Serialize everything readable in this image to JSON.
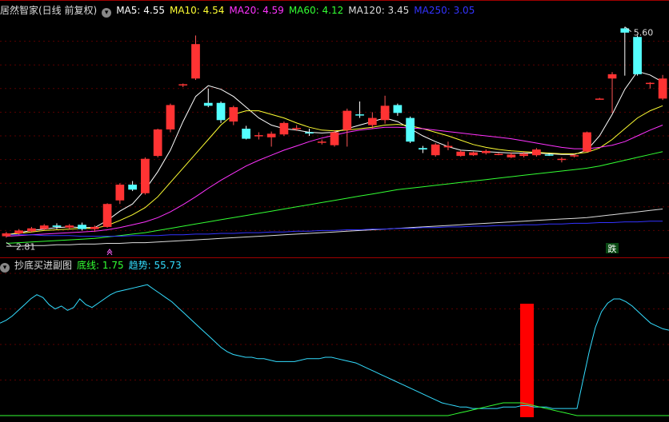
{
  "main_header": {
    "title": "居然智家(日线 前复权)",
    "ma_items": [
      {
        "label": "MA5: 4.55",
        "color": "#ffffff"
      },
      {
        "label": "MA10: 4.54",
        "color": "#ffff33"
      },
      {
        "label": "MA20: 4.59",
        "color": "#ff33ff"
      },
      {
        "label": "MA60: 4.12",
        "color": "#33ff33"
      },
      {
        "label": "MA120: 3.45",
        "color": "#dddddd"
      },
      {
        "label": "MA250: 3.05",
        "color": "#3333ff"
      }
    ]
  },
  "sub_header": {
    "title": "抄底买进副图",
    "items": [
      {
        "label": "底线: 1.75",
        "color": "#33ff33"
      },
      {
        "label": "趋势: 55.73",
        "color": "#33ddff"
      }
    ]
  },
  "annotations": {
    "high_label": "5.60",
    "low_label": "2.81",
    "sell_marker": "跌"
  },
  "chart_data": [
    {
      "type": "candlestick",
      "title": "居然智家(日线 前复权)",
      "y_range": [
        2.55,
        5.85
      ],
      "x_count": 53,
      "candles": [
        [
          2.8,
          2.86,
          2.78,
          2.84
        ],
        [
          2.84,
          2.9,
          2.82,
          2.88
        ],
        [
          2.87,
          2.93,
          2.85,
          2.91
        ],
        [
          2.9,
          2.97,
          2.88,
          2.95
        ],
        [
          2.95,
          2.98,
          2.9,
          2.93
        ],
        [
          2.92,
          2.97,
          2.89,
          2.95
        ],
        [
          2.96,
          2.99,
          2.88,
          2.9
        ],
        [
          2.9,
          2.95,
          2.86,
          2.93
        ],
        [
          2.93,
          3.26,
          2.92,
          3.25
        ],
        [
          3.3,
          3.54,
          3.25,
          3.52
        ],
        [
          3.52,
          3.57,
          3.43,
          3.45
        ],
        [
          3.4,
          3.9,
          3.38,
          3.88
        ],
        [
          3.92,
          4.3,
          3.9,
          4.29
        ],
        [
          4.29,
          4.65,
          4.25,
          4.63
        ],
        [
          4.92,
          4.93,
          4.88,
          4.92
        ],
        [
          5.0,
          5.6,
          4.98,
          5.48
        ],
        [
          4.66,
          4.86,
          4.6,
          4.62
        ],
        [
          4.66,
          4.68,
          4.38,
          4.42
        ],
        [
          4.4,
          4.62,
          4.35,
          4.6
        ],
        [
          4.3,
          4.34,
          4.15,
          4.16
        ],
        [
          4.2,
          4.25,
          4.15,
          4.21
        ],
        [
          4.18,
          4.26,
          4.05,
          4.23
        ],
        [
          4.22,
          4.4,
          4.2,
          4.38
        ],
        [
          4.3,
          4.35,
          4.27,
          4.31
        ],
        [
          4.25,
          4.3,
          4.2,
          4.24
        ],
        [
          4.12,
          4.15,
          4.08,
          4.12
        ],
        [
          4.07,
          4.28,
          4.05,
          4.25
        ],
        [
          4.28,
          4.58,
          4.05,
          4.55
        ],
        [
          4.5,
          4.68,
          4.45,
          4.49
        ],
        [
          4.35,
          4.53,
          4.3,
          4.45
        ],
        [
          4.42,
          4.76,
          4.37,
          4.62
        ],
        [
          4.63,
          4.65,
          4.48,
          4.52
        ],
        [
          4.45,
          4.47,
          4.1,
          4.12
        ],
        [
          4.03,
          4.06,
          3.96,
          4.01
        ],
        [
          3.93,
          4.1,
          3.91,
          4.08
        ],
        [
          4.04,
          4.12,
          4.0,
          4.06
        ],
        [
          3.92,
          4.0,
          3.91,
          3.98
        ],
        [
          3.93,
          3.98,
          3.92,
          3.97
        ],
        [
          3.96,
          4.01,
          3.94,
          3.99
        ],
        [
          3.94,
          3.96,
          3.93,
          3.95
        ],
        [
          3.9,
          3.97,
          3.89,
          3.94
        ],
        [
          3.92,
          3.98,
          3.9,
          3.95
        ],
        [
          3.93,
          4.03,
          3.91,
          4.01
        ],
        [
          3.94,
          3.96,
          3.92,
          3.93
        ],
        [
          3.88,
          3.9,
          3.83,
          3.88
        ],
        [
          3.92,
          3.95,
          3.9,
          3.93
        ],
        [
          3.98,
          4.26,
          3.97,
          4.25
        ],
        [
          4.72,
          4.73,
          4.71,
          4.72
        ],
        [
          5.0,
          5.09,
          4.52,
          5.06
        ],
        [
          5.7,
          5.72,
          5.04,
          5.64
        ],
        [
          5.58,
          5.6,
          5.04,
          5.06
        ],
        [
          4.94,
          4.95,
          4.86,
          4.94
        ],
        [
          4.72,
          5.05,
          4.7,
          5.0
        ]
      ],
      "candles_fields": [
        "open",
        "high",
        "low",
        "close"
      ],
      "ma": {
        "MA5": [
          2.82,
          2.85,
          2.88,
          2.9,
          2.92,
          2.93,
          2.92,
          2.92,
          3.02,
          3.15,
          3.25,
          3.45,
          3.7,
          4.0,
          4.4,
          4.75,
          4.9,
          4.85,
          4.75,
          4.6,
          4.45,
          4.35,
          4.3,
          4.28,
          4.25,
          4.24,
          4.25,
          4.3,
          4.35,
          4.4,
          4.45,
          4.4,
          4.3,
          4.2,
          4.12,
          4.05,
          4.0,
          3.99,
          3.98,
          3.97,
          3.96,
          3.96,
          3.96,
          3.95,
          3.94,
          3.94,
          4.0,
          4.2,
          4.5,
          4.85,
          5.1,
          5.05,
          4.95
        ],
        "MA10": [
          2.82,
          2.84,
          2.86,
          2.88,
          2.89,
          2.9,
          2.91,
          2.91,
          2.95,
          3.02,
          3.1,
          3.2,
          3.35,
          3.55,
          3.75,
          3.95,
          4.15,
          4.35,
          4.5,
          4.55,
          4.55,
          4.5,
          4.45,
          4.38,
          4.32,
          4.28,
          4.27,
          4.28,
          4.3,
          4.32,
          4.35,
          4.36,
          4.34,
          4.3,
          4.25,
          4.2,
          4.14,
          4.08,
          4.04,
          4.01,
          3.99,
          3.98,
          3.97,
          3.96,
          3.95,
          3.95,
          3.97,
          4.03,
          4.15,
          4.3,
          4.45,
          4.55,
          4.62
        ],
        "MA20": [
          2.8,
          2.81,
          2.82,
          2.83,
          2.84,
          2.85,
          2.86,
          2.87,
          2.89,
          2.92,
          2.96,
          3.0,
          3.06,
          3.14,
          3.24,
          3.35,
          3.47,
          3.58,
          3.68,
          3.78,
          3.86,
          3.93,
          4.0,
          4.06,
          4.12,
          4.17,
          4.21,
          4.25,
          4.28,
          4.3,
          4.32,
          4.32,
          4.31,
          4.3,
          4.28,
          4.26,
          4.24,
          4.22,
          4.2,
          4.18,
          4.16,
          4.13,
          4.1,
          4.07,
          4.04,
          4.02,
          4.02,
          4.04,
          4.07,
          4.12,
          4.2,
          4.28,
          4.35
        ],
        "MA60": [
          2.7,
          2.71,
          2.72,
          2.73,
          2.74,
          2.75,
          2.76,
          2.77,
          2.79,
          2.81,
          2.83,
          2.85,
          2.88,
          2.91,
          2.94,
          2.97,
          3.0,
          3.03,
          3.06,
          3.09,
          3.12,
          3.15,
          3.18,
          3.21,
          3.24,
          3.27,
          3.3,
          3.33,
          3.36,
          3.39,
          3.42,
          3.45,
          3.47,
          3.49,
          3.51,
          3.53,
          3.55,
          3.57,
          3.59,
          3.61,
          3.63,
          3.65,
          3.67,
          3.69,
          3.71,
          3.73,
          3.75,
          3.78,
          3.82,
          3.86,
          3.9,
          3.94,
          3.98
        ],
        "MA120": [
          2.66,
          2.66,
          2.67,
          2.67,
          2.68,
          2.68,
          2.69,
          2.69,
          2.7,
          2.7,
          2.71,
          2.71,
          2.72,
          2.73,
          2.74,
          2.75,
          2.76,
          2.77,
          2.78,
          2.79,
          2.8,
          2.81,
          2.82,
          2.83,
          2.84,
          2.85,
          2.86,
          2.87,
          2.88,
          2.89,
          2.9,
          2.91,
          2.92,
          2.93,
          2.94,
          2.95,
          2.96,
          2.97,
          2.98,
          2.99,
          3.0,
          3.01,
          3.02,
          3.03,
          3.04,
          3.05,
          3.06,
          3.08,
          3.1,
          3.12,
          3.14,
          3.16,
          3.18
        ],
        "MA250": [
          2.82,
          2.82,
          2.82,
          2.81,
          2.81,
          2.81,
          2.8,
          2.8,
          2.8,
          2.8,
          2.81,
          2.81,
          2.81,
          2.82,
          2.82,
          2.83,
          2.83,
          2.84,
          2.84,
          2.85,
          2.85,
          2.86,
          2.86,
          2.87,
          2.87,
          2.88,
          2.88,
          2.89,
          2.89,
          2.9,
          2.9,
          2.91,
          2.91,
          2.92,
          2.92,
          2.93,
          2.93,
          2.94,
          2.94,
          2.95,
          2.95,
          2.96,
          2.96,
          2.97,
          2.97,
          2.98,
          2.98,
          2.99,
          2.99,
          3.0,
          3.0,
          3.01,
          3.01
        ]
      }
    },
    {
      "type": "line",
      "title": "抄底买进副图",
      "y_range": [
        0,
        100
      ],
      "series": [
        {
          "name": "趋势",
          "color": "#33ddff",
          "values": [
            65,
            67,
            70,
            74,
            78,
            82,
            85,
            83,
            78,
            75,
            77,
            74,
            76,
            82,
            78,
            76,
            79,
            82,
            85,
            87,
            88,
            89,
            90,
            91,
            92,
            89,
            86,
            83,
            80,
            76,
            72,
            68,
            64,
            60,
            56,
            52,
            48,
            45,
            43,
            42,
            41,
            41,
            40,
            40,
            39,
            38,
            38,
            38,
            38,
            39,
            40,
            40,
            40,
            41,
            41,
            40,
            39,
            38,
            37,
            35,
            33,
            31,
            29,
            27,
            25,
            23,
            21,
            19,
            17,
            15,
            13,
            11,
            9,
            8,
            7,
            6,
            6,
            5,
            5,
            5,
            5,
            5,
            6,
            6,
            6,
            7,
            7,
            6,
            6,
            6,
            5,
            5,
            5,
            5,
            5,
            25,
            45,
            62,
            73,
            79,
            82,
            82,
            80,
            77,
            73,
            69,
            65,
            63,
            61,
            60
          ]
        },
        {
          "name": "底线",
          "color": "#33ff33",
          "values": [
            0,
            0,
            0,
            0,
            0,
            0,
            0,
            0,
            0,
            0,
            0,
            0,
            0,
            0,
            0,
            0,
            0,
            0,
            0,
            0,
            0,
            0,
            0,
            0,
            0,
            0,
            0,
            0,
            0,
            0,
            0,
            0,
            0,
            0,
            0,
            0,
            0,
            0,
            0,
            0,
            0,
            0,
            0,
            0,
            0,
            0,
            0,
            0,
            0,
            0,
            0,
            0,
            0,
            0,
            0,
            0,
            0,
            0,
            0,
            0,
            0,
            0,
            0,
            0,
            0,
            0,
            0,
            0,
            0,
            0,
            0,
            0,
            0,
            0,
            1,
            2,
            3,
            4,
            5,
            6,
            7,
            8,
            9,
            9,
            9,
            9,
            8,
            7,
            6,
            5,
            4,
            3,
            2,
            1,
            0,
            0,
            0,
            0,
            0,
            0,
            0,
            0,
            0,
            0,
            0,
            0,
            0,
            0,
            0,
            0
          ]
        }
      ],
      "signal_bar": {
        "index": 45,
        "value": 100
      }
    }
  ]
}
